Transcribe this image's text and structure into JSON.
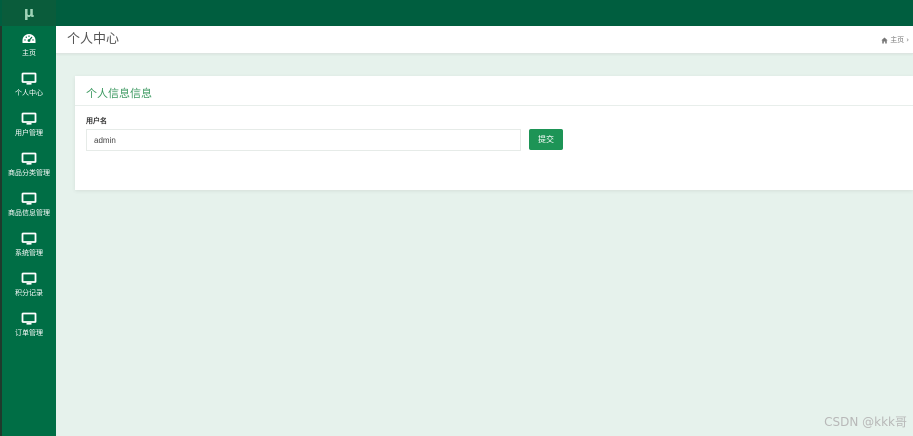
{
  "app": {
    "logo_text": "μ"
  },
  "sidebar": {
    "items": [
      {
        "label": "主页",
        "icon": "dashboard-icon"
      },
      {
        "label": "个人中心",
        "icon": "monitor-icon"
      },
      {
        "label": "用户管理",
        "icon": "monitor-icon"
      },
      {
        "label": "商品分类管理",
        "icon": "monitor-icon"
      },
      {
        "label": "商品信息管理",
        "icon": "monitor-icon"
      },
      {
        "label": "系统管理",
        "icon": "monitor-icon"
      },
      {
        "label": "积分记录",
        "icon": "monitor-icon"
      },
      {
        "label": "订单管理",
        "icon": "monitor-icon"
      }
    ]
  },
  "header": {
    "page_title": "个人中心",
    "breadcrumb_home": "主页",
    "breadcrumb_sep": "›"
  },
  "panel": {
    "title": "个人信息信息",
    "username_label": "用户名",
    "username_value": "admin",
    "submit_label": "提交"
  },
  "watermark": "CSDN @kkk哥",
  "colors": {
    "topbar": "#005e3f",
    "sidebar": "#006e45",
    "main_bg": "#e6f2ec",
    "accent": "#3e9a62",
    "button": "#1d9456"
  }
}
